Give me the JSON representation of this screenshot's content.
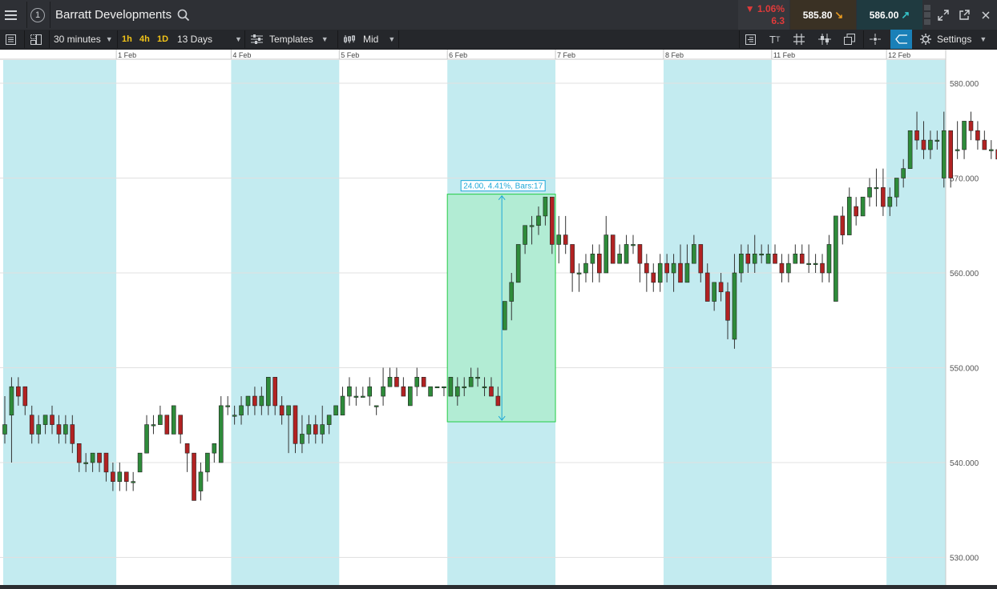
{
  "header": {
    "title": "Barratt Developments",
    "alert_number": "1",
    "change_pct": "▼ 1.06%",
    "change_abs": "6.3",
    "sell_price": "585.80",
    "buy_price": "586.00"
  },
  "toolbar": {
    "interval": "30 minutes",
    "quick_intervals": [
      "1h",
      "4h",
      "1D"
    ],
    "range": "13 Days",
    "templates_label": "Templates",
    "price_type": "Mid",
    "settings_label": "Settings"
  },
  "colors": {
    "up_candle": "#2e8b3a",
    "down_candle": "#b22222",
    "session_band": "#c3ebf0",
    "measure_fill": "#b2ecd4",
    "measure_border": "#22cc44",
    "measure_label": "#1fa8d8"
  },
  "chart_data": {
    "type": "candlestick",
    "x_tick_labels": [
      "1 Feb",
      "4 Feb",
      "5 Feb",
      "6 Feb",
      "7 Feb",
      "8 Feb",
      "11 Feb",
      "12 Feb"
    ],
    "y_tick_labels": [
      "580.000",
      "570.000",
      "560.000",
      "550.000",
      "540.000",
      "530.000"
    ],
    "ylim": [
      529,
      581
    ],
    "grid": true,
    "measurement_label": "24.00, 4.41%, Bars:17",
    "measurement_range": [
      544.3,
      568.3
    ],
    "candles": [
      [
        543,
        547,
        542,
        544
      ],
      [
        545,
        549,
        540,
        548
      ],
      [
        548,
        549,
        546,
        547
      ],
      [
        548,
        548,
        545,
        546
      ],
      [
        545,
        546,
        542,
        543
      ],
      [
        543,
        545,
        542,
        544
      ],
      [
        544,
        545,
        543,
        545
      ],
      [
        545,
        546,
        543,
        544
      ],
      [
        544,
        545,
        542,
        543
      ],
      [
        543,
        545,
        542,
        544
      ],
      [
        544,
        545,
        541,
        542
      ],
      [
        542,
        542,
        539,
        540
      ],
      [
        540,
        541,
        539,
        540
      ],
      [
        540,
        541,
        539,
        541
      ],
      [
        541,
        541,
        539,
        540
      ],
      [
        541,
        541,
        538,
        539
      ],
      [
        539,
        540,
        537,
        538
      ],
      [
        538,
        540,
        537,
        539
      ],
      [
        539,
        539,
        537,
        538
      ],
      [
        538,
        539,
        537,
        538
      ],
      [
        539,
        541,
        539,
        541
      ],
      [
        541,
        545,
        541,
        544
      ],
      [
        544,
        545,
        543,
        544
      ],
      [
        544,
        546,
        544,
        545
      ],
      [
        545,
        545,
        543,
        543
      ],
      [
        543,
        546,
        543,
        546
      ],
      [
        545,
        545,
        542,
        543
      ],
      [
        542,
        542,
        539,
        541
      ],
      [
        541,
        541,
        536,
        536
      ],
      [
        537,
        540,
        536,
        539
      ],
      [
        539,
        541,
        538,
        541
      ],
      [
        541,
        542,
        540,
        542
      ],
      [
        540,
        547,
        540,
        546
      ],
      [
        546,
        547,
        545,
        546
      ],
      [
        545,
        546,
        544,
        545
      ],
      [
        545,
        547,
        544,
        546
      ],
      [
        546,
        547,
        545,
        547
      ],
      [
        547,
        548,
        545,
        546
      ],
      [
        546,
        548,
        545,
        547
      ],
      [
        546,
        549,
        545,
        549
      ],
      [
        549,
        549,
        545,
        546
      ],
      [
        546,
        547,
        544,
        545
      ],
      [
        545,
        546,
        541,
        546
      ],
      [
        546,
        546,
        541,
        542
      ],
      [
        542,
        545,
        541,
        543
      ],
      [
        543,
        545,
        542,
        544
      ],
      [
        544,
        545,
        542,
        543
      ],
      [
        543,
        546,
        542,
        544
      ],
      [
        544,
        545,
        543,
        545
      ],
      [
        545,
        546,
        545,
        546
      ],
      [
        545,
        548,
        545,
        547
      ],
      [
        547,
        549,
        546,
        548
      ],
      [
        547,
        548,
        546,
        547
      ],
      [
        547,
        548,
        547,
        547
      ],
      [
        547,
        549,
        546,
        548
      ],
      [
        546,
        546,
        545,
        546
      ],
      [
        547,
        550,
        546,
        548
      ],
      [
        548,
        550,
        548,
        549
      ],
      [
        549,
        550,
        548,
        548
      ],
      [
        548,
        549,
        547,
        547
      ],
      [
        546,
        548,
        546,
        548
      ],
      [
        548,
        550,
        547,
        549
      ],
      [
        549,
        549,
        548,
        548
      ],
      [
        547,
        548,
        547,
        548
      ],
      [
        548,
        548,
        548,
        548
      ],
      [
        548,
        548,
        547,
        548
      ],
      [
        547,
        549,
        547,
        549
      ],
      [
        547,
        549,
        546,
        548
      ],
      [
        548,
        549,
        547,
        548
      ],
      [
        548,
        550,
        548,
        549
      ],
      [
        549,
        550,
        548,
        549
      ],
      [
        548,
        549,
        547,
        548
      ],
      [
        548,
        549,
        547,
        547
      ],
      [
        547,
        548,
        546,
        546
      ],
      [
        554,
        557,
        554,
        557
      ],
      [
        557,
        560,
        555,
        559
      ],
      [
        559,
        563,
        559,
        563
      ],
      [
        563,
        565,
        562,
        565
      ],
      [
        565,
        566,
        563,
        565
      ],
      [
        565,
        567,
        564,
        566
      ],
      [
        566,
        568,
        565,
        568
      ],
      [
        568,
        568,
        562,
        563
      ],
      [
        563,
        566,
        561,
        564
      ],
      [
        564,
        566,
        562,
        563
      ],
      [
        563,
        563,
        558,
        560
      ],
      [
        560,
        561,
        558,
        560
      ],
      [
        560,
        562,
        559,
        561
      ],
      [
        561,
        563,
        559,
        562
      ],
      [
        562,
        563,
        559,
        560
      ],
      [
        560,
        566,
        560,
        564
      ],
      [
        564,
        564,
        561,
        561
      ],
      [
        561,
        563,
        561,
        562
      ],
      [
        561,
        564,
        561,
        563
      ],
      [
        563,
        564,
        562,
        563
      ],
      [
        563,
        563,
        559,
        561
      ],
      [
        561,
        562,
        558,
        560
      ],
      [
        560,
        561,
        558,
        559
      ],
      [
        559,
        562,
        558,
        561
      ],
      [
        561,
        562,
        559,
        560
      ],
      [
        560,
        562,
        558,
        561
      ],
      [
        561,
        563,
        559,
        559
      ],
      [
        559,
        563,
        559,
        561
      ],
      [
        561,
        564,
        561,
        563
      ],
      [
        563,
        563,
        559,
        560
      ],
      [
        560,
        561,
        557,
        557
      ],
      [
        557,
        559,
        556,
        559
      ],
      [
        559,
        560,
        557,
        558
      ],
      [
        558,
        559,
        553,
        555
      ],
      [
        553,
        562,
        552,
        560
      ],
      [
        560,
        563,
        559,
        562
      ],
      [
        562,
        563,
        560,
        561
      ],
      [
        561,
        564,
        560,
        562
      ],
      [
        562,
        563,
        561,
        562
      ],
      [
        561,
        563,
        561,
        562
      ],
      [
        562,
        563,
        561,
        561
      ],
      [
        561,
        562,
        559,
        560
      ],
      [
        560,
        562,
        559,
        561
      ],
      [
        561,
        563,
        561,
        562
      ],
      [
        562,
        563,
        561,
        561
      ],
      [
        561,
        563,
        560,
        561
      ],
      [
        561,
        562,
        560,
        561
      ],
      [
        561,
        562,
        559,
        560
      ],
      [
        560,
        564,
        559,
        563
      ],
      [
        557,
        566,
        557,
        566
      ],
      [
        566,
        567,
        563,
        564
      ],
      [
        564,
        569,
        564,
        568
      ],
      [
        567,
        568,
        565,
        566
      ],
      [
        566,
        568,
        566,
        568
      ],
      [
        568,
        570,
        567,
        569
      ],
      [
        569,
        571,
        567,
        569
      ],
      [
        569,
        571,
        566,
        567
      ],
      [
        567,
        569,
        566,
        568
      ],
      [
        568,
        570,
        567,
        570
      ],
      [
        570,
        572,
        569,
        571
      ],
      [
        571,
        575,
        571,
        575
      ],
      [
        575,
        577,
        573,
        574
      ],
      [
        574,
        576,
        572,
        573
      ],
      [
        573,
        575,
        572,
        574
      ],
      [
        574,
        575,
        573,
        574
      ],
      [
        570,
        577,
        569,
        575
      ],
      [
        575,
        575,
        569,
        570
      ],
      [
        573,
        576,
        572,
        573
      ],
      [
        573,
        576,
        572,
        576
      ],
      [
        576,
        577,
        574,
        575
      ],
      [
        575,
        576,
        573,
        574
      ],
      [
        574,
        575,
        573,
        573
      ],
      [
        573,
        574,
        572,
        573
      ],
      [
        573,
        573,
        571,
        572
      ],
      [
        572,
        572,
        568,
        568
      ]
    ]
  }
}
